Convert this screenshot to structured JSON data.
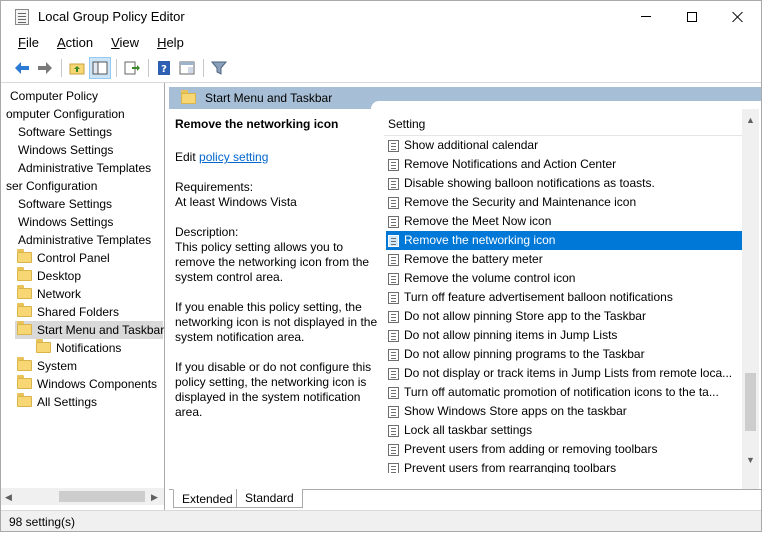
{
  "window": {
    "title": "Local Group Policy Editor"
  },
  "menu": [
    {
      "acc": "F",
      "rest": "ile"
    },
    {
      "acc": "A",
      "rest": "ction"
    },
    {
      "acc": "V",
      "rest": "iew"
    },
    {
      "acc": "H",
      "rest": "elp"
    }
  ],
  "tree": {
    "items": [
      {
        "label": "Computer Policy"
      },
      {
        "label": "omputer Configuration"
      },
      {
        "label": "Software Settings"
      },
      {
        "label": "Windows Settings"
      },
      {
        "label": "Administrative Templates"
      },
      {
        "label": "ser Configuration"
      },
      {
        "label": "Software Settings"
      },
      {
        "label": "Windows Settings"
      },
      {
        "label": "Administrative Templates"
      },
      {
        "label": "Control Panel"
      },
      {
        "label": "Desktop"
      },
      {
        "label": "Network"
      },
      {
        "label": "Shared Folders"
      },
      {
        "label": "Start Menu and Taskbar"
      },
      {
        "label": "Notifications"
      },
      {
        "label": "System"
      },
      {
        "label": "Windows Components"
      },
      {
        "label": "All Settings"
      }
    ]
  },
  "header": {
    "title": "Start Menu and Taskbar"
  },
  "description": {
    "title": "Remove the networking icon",
    "edit_prefix": "Edit",
    "edit_link": "policy setting",
    "requirements_label": "Requirements:",
    "requirements_value": "At least Windows Vista",
    "description_label": "Description:",
    "p1": "This policy setting allows you to remove the networking icon from the system control area.",
    "p2": "If you enable this policy setting, the networking icon is not displayed in the system notification area.",
    "p3": "If you disable or do not configure this policy setting, the networking icon is displayed in the system notification area."
  },
  "list": {
    "column_header": "Setting",
    "rows": [
      "Show additional calendar",
      "Remove Notifications and Action Center",
      "Disable showing balloon notifications as toasts.",
      "Remove the Security and Maintenance icon",
      "Remove the Meet Now icon",
      "Remove the networking icon",
      "Remove the battery meter",
      "Remove the volume control icon",
      "Turn off feature advertisement balloon notifications",
      "Do not allow pinning Store app to the Taskbar",
      "Do not allow pinning items in Jump Lists",
      "Do not allow pinning programs to the Taskbar",
      "Do not display or track items in Jump Lists from remote loca...",
      "Turn off automatic promotion of notification icons to the ta...",
      "Show Windows Store apps on the taskbar",
      "Lock all taskbar settings",
      "Prevent users from adding or removing toolbars",
      "Prevent users from rearranging toolbars"
    ],
    "selected_index": 5
  },
  "tabs": {
    "extended": "Extended",
    "standard": "Standard"
  },
  "status": {
    "text": "98 setting(s)"
  },
  "colors": {
    "selection": "#0078d7",
    "header_band": "#a7bfd6",
    "link": "#0066cc"
  }
}
